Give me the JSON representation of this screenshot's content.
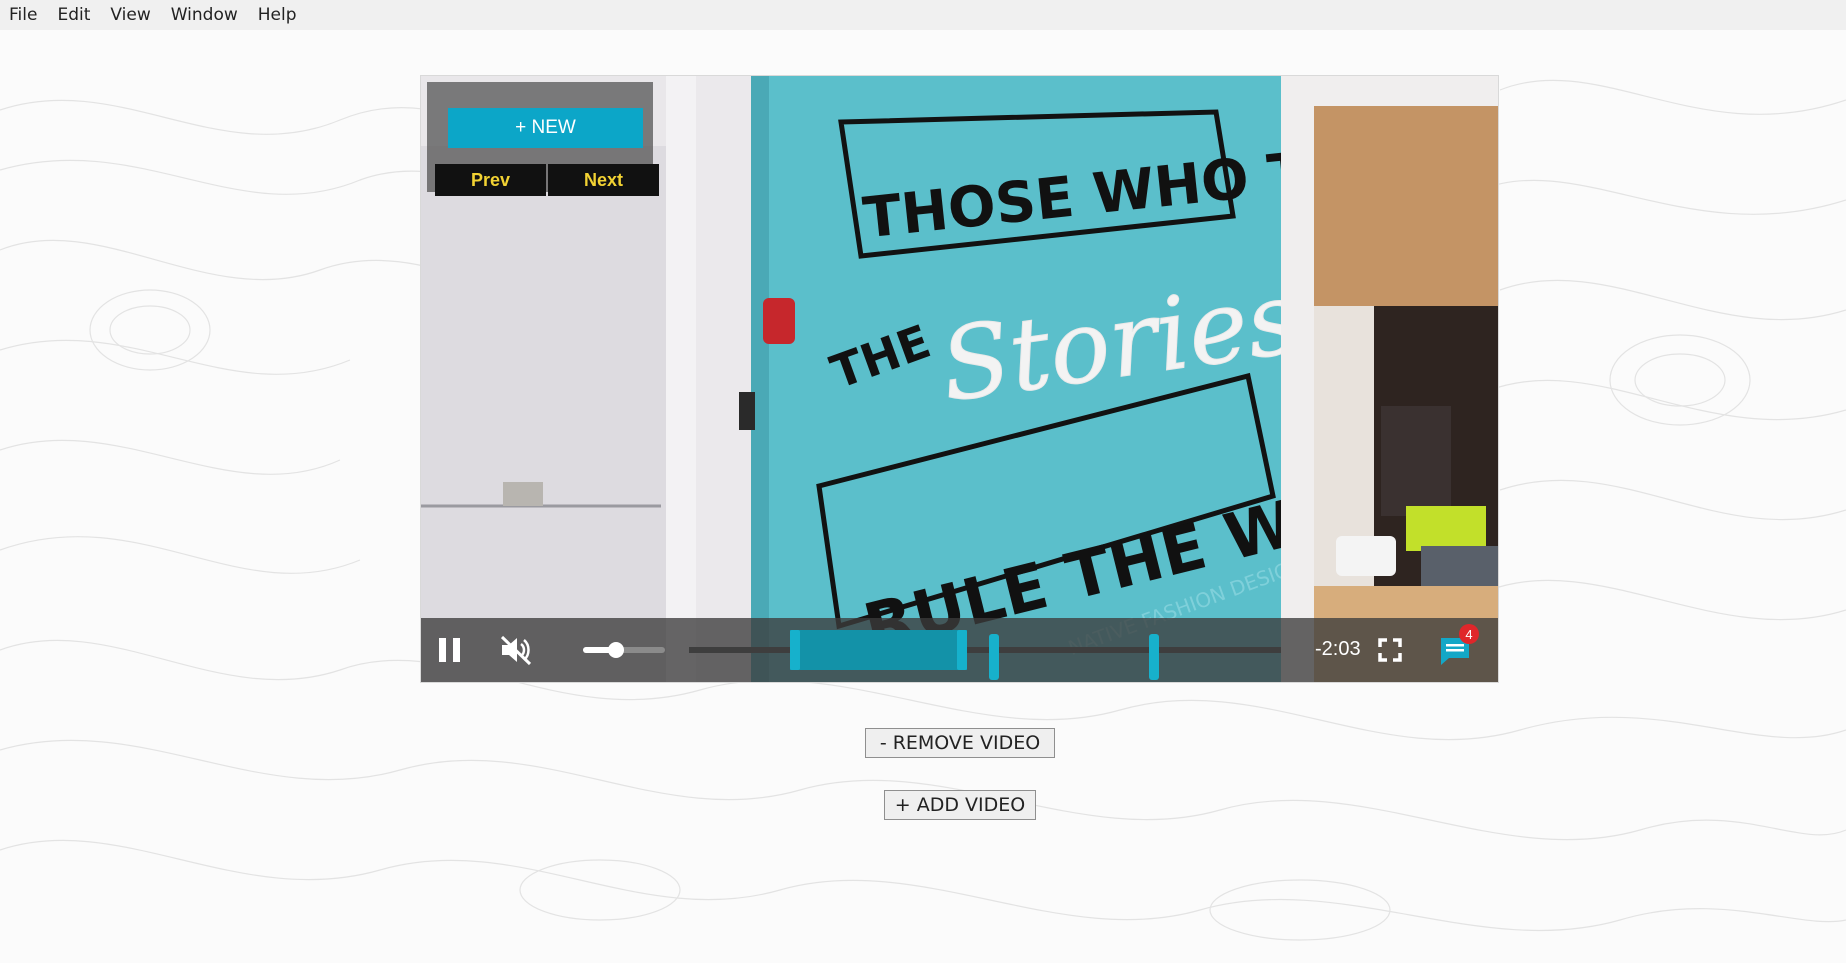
{
  "menu": {
    "items": [
      {
        "label": "File"
      },
      {
        "label": "Edit"
      },
      {
        "label": "View"
      },
      {
        "label": "Window"
      },
      {
        "label": "Help"
      }
    ]
  },
  "video": {
    "mural_text": {
      "line1": "THOSE WHO TELL",
      "line2a": "THE",
      "line2b": "Stories",
      "line3": "RULE THE WORLD",
      "signature": "NATIVE FASHION DESIGN"
    },
    "panel": {
      "new_label": "+ NEW",
      "prev_label": "Prev",
      "next_label": "Next"
    },
    "controls": {
      "muted": true,
      "volume_level": 0.4,
      "time_remaining": "-2:03",
      "comment_count": "4",
      "annotation_region": {
        "start": 0.17,
        "end": 0.47
      },
      "annotation_markers": [
        0.17,
        0.47,
        0.515,
        0.785
      ],
      "icons": {
        "play_state": "pause-icon",
        "volume": "muted-speaker-icon",
        "fullscreen": "fullscreen-icon",
        "comments": "chat-bubble-icon"
      }
    }
  },
  "actions": {
    "remove_label": "- REMOVE VIDEO",
    "add_label": "+ ADD VIDEO"
  },
  "colors": {
    "accent": "#0ca6c8",
    "nav_text": "#f2d233",
    "badge": "#e0262a",
    "mural_wall": "#5bbfcb"
  }
}
